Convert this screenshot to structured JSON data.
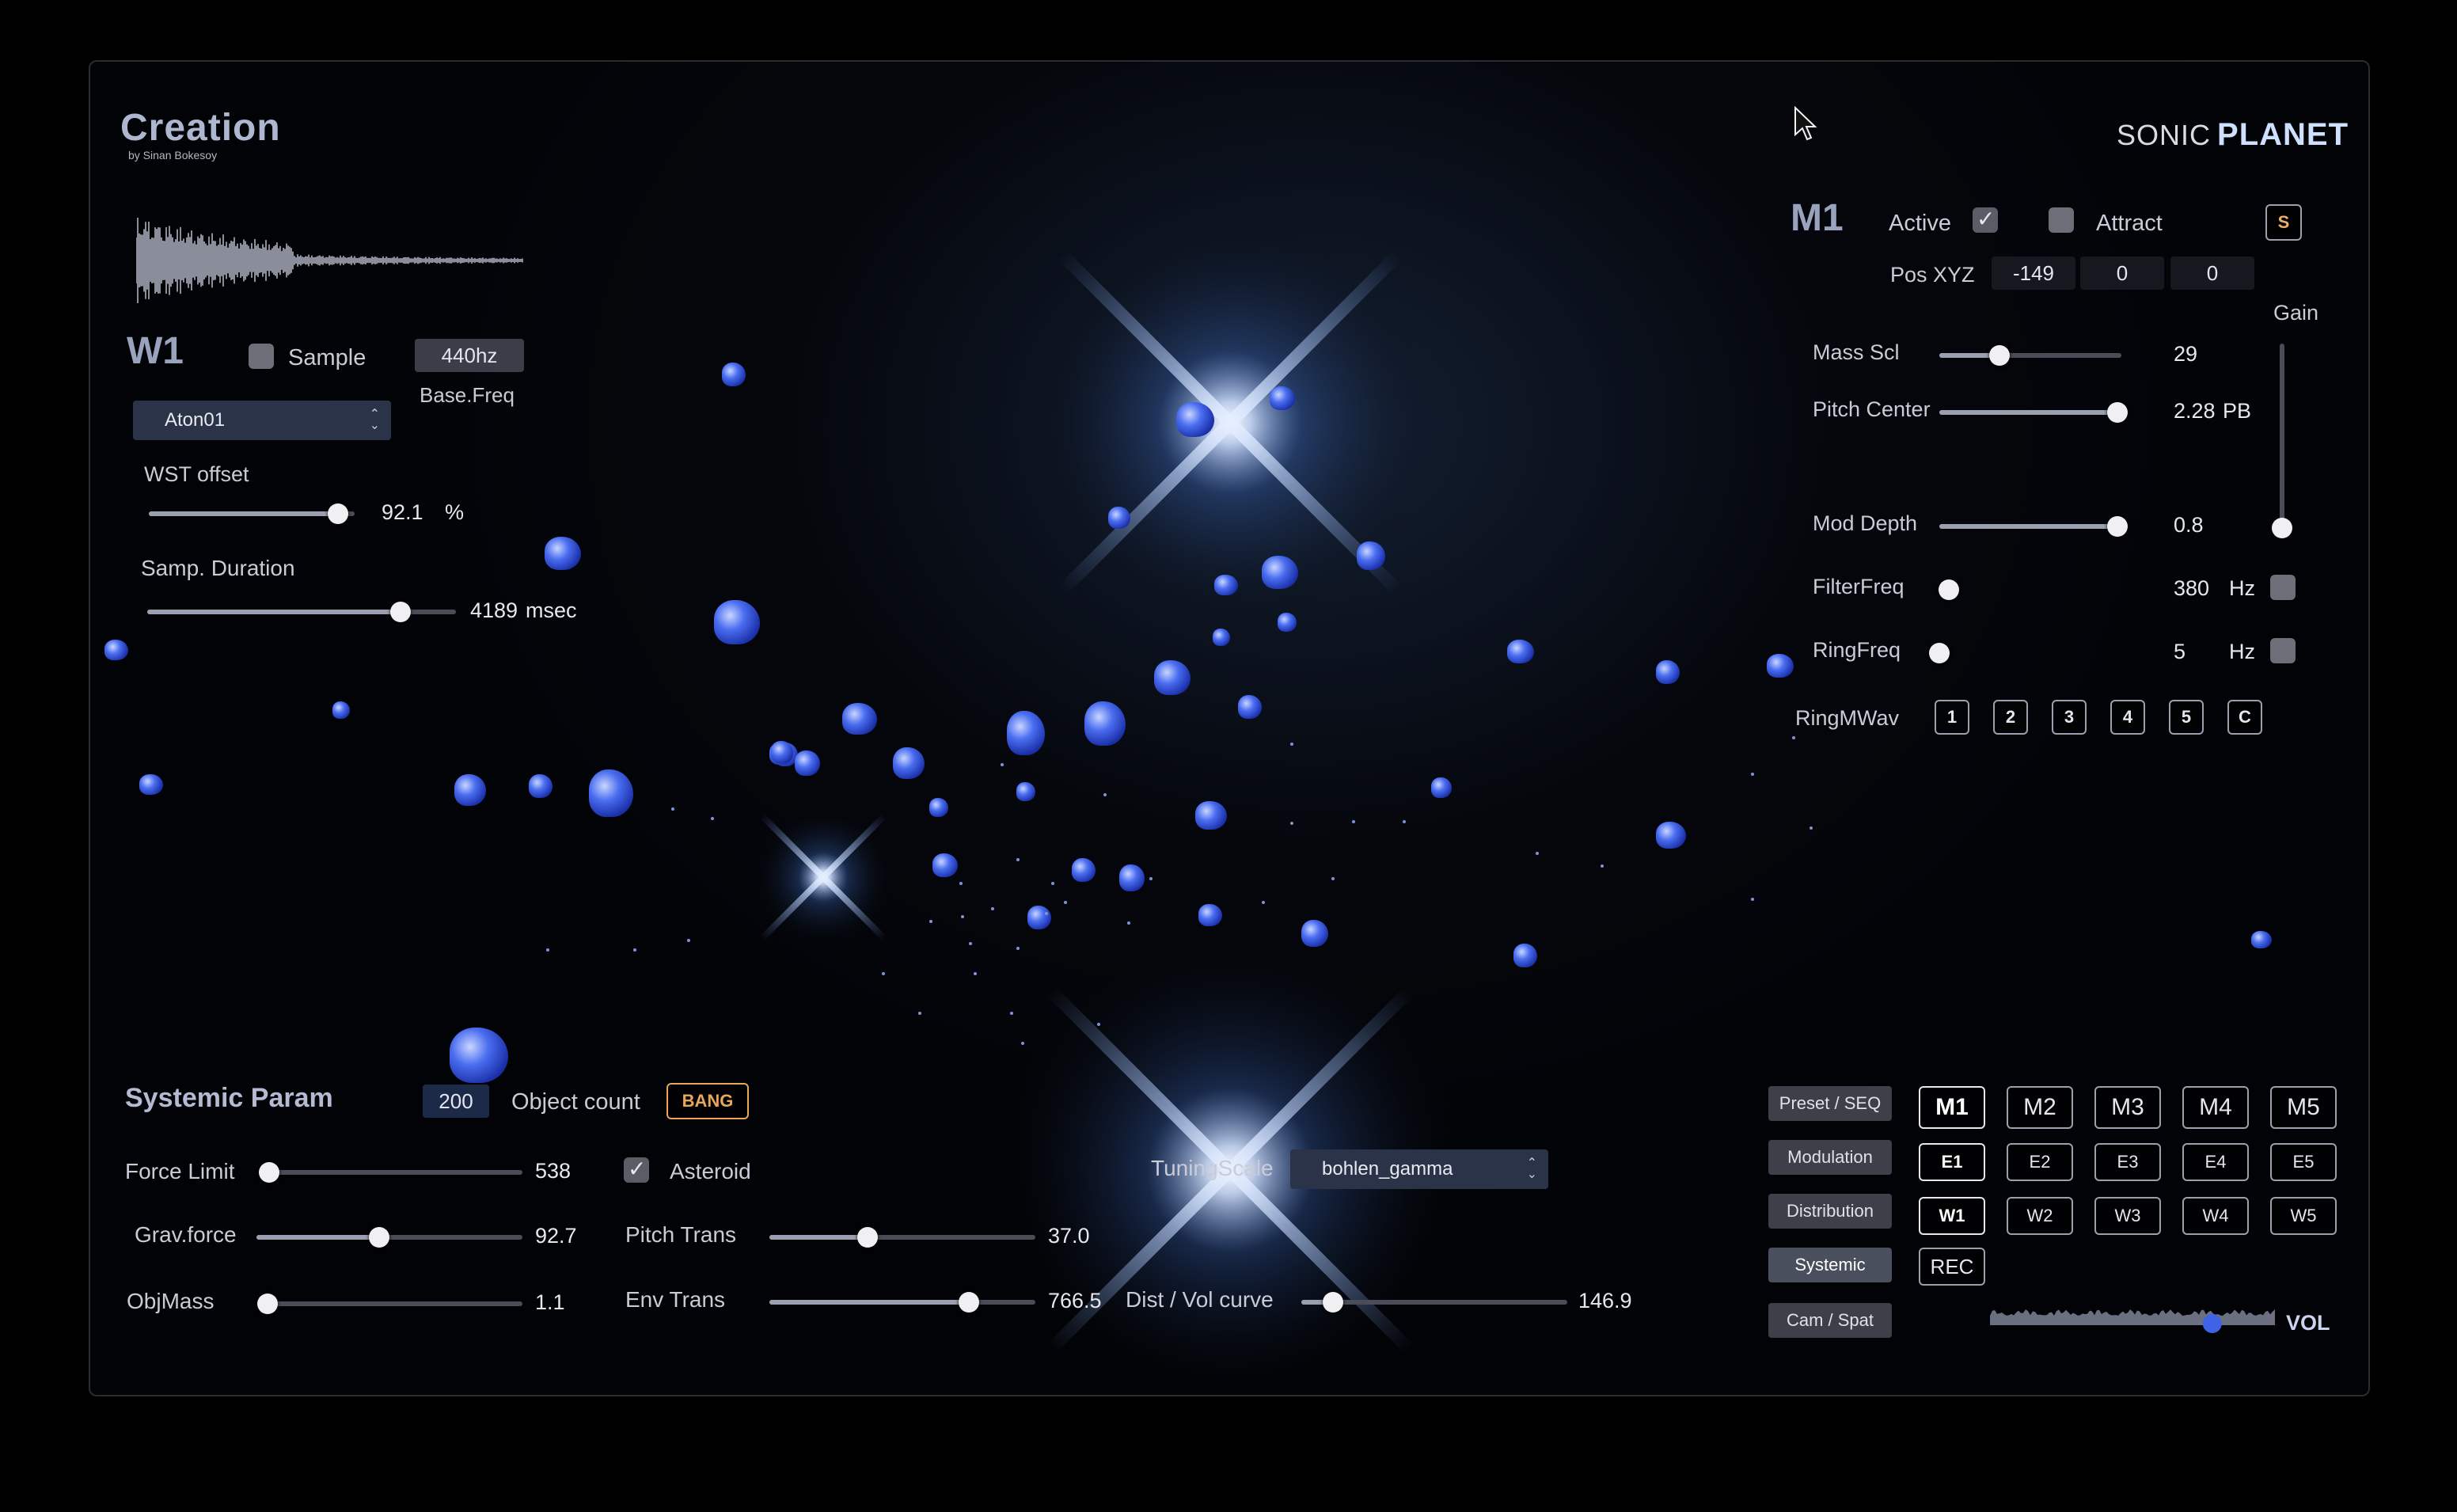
{
  "app": {
    "title": "Creation",
    "subtitle": "by Sinan Bokesoy",
    "brand_sonic": "SONIC",
    "brand_planet": "PLANET"
  },
  "colors": {
    "background": "#000000",
    "space": "#05070d",
    "rock": "#3b5be8",
    "accent": "#9db4ff",
    "bang": "#e8a85a"
  },
  "icons": {
    "cursor": "mouse-pointer-icon",
    "dropdown": "chevron-updown-icon",
    "check": "checkmark-icon"
  },
  "waveform": {
    "name": "W1",
    "sample_label": "Sample",
    "sample_checked": false,
    "base_freq_value": "440hz",
    "base_freq_label": "Base.Freq",
    "preset_select": "Aton01",
    "wst_offset": {
      "label": "WST offset",
      "value": "92.1",
      "unit": "%",
      "fraction": 0.92
    },
    "samp_duration": {
      "label": "Samp. Duration",
      "value": "4189",
      "unit": "msec",
      "fraction": 0.82
    }
  },
  "mass": {
    "name": "M1",
    "active_label": "Active",
    "active_checked": true,
    "attract_label": "Attract",
    "attract_checked": false,
    "s_button": "S",
    "pos_label": "Pos XYZ",
    "pos": [
      "-149",
      "0",
      "0"
    ],
    "gain_label": "Gain",
    "gain_fraction": 0.0,
    "params": [
      {
        "label": "Mass Scl",
        "value": "29",
        "unit": "",
        "fraction": 0.33,
        "toggle": false
      },
      {
        "label": "Pitch Center",
        "value": "2.28",
        "unit": "PB",
        "fraction": 0.98,
        "toggle": false
      },
      {
        "label": "Mod Depth",
        "value": "0.8",
        "unit": "",
        "fraction": 0.98,
        "toggle": false
      },
      {
        "label": "FilterFreq",
        "value": "380",
        "unit": "Hz",
        "fraction": 0.05,
        "toggle": true
      },
      {
        "label": "RingFreq",
        "value": "5",
        "unit": "Hz",
        "fraction": 0.0,
        "toggle": true
      }
    ],
    "ring_wav_label": "RingMWav",
    "ring_wav_buttons": [
      "1",
      "2",
      "3",
      "4",
      "5",
      "C"
    ]
  },
  "systemic": {
    "title": "Systemic Param",
    "object_count_value": "200",
    "object_count_label": "Object count",
    "bang": "BANG",
    "force_limit": {
      "label": "Force Limit",
      "value": "538",
      "fraction": 0.0
    },
    "grav_force": {
      "label": "Grav.force",
      "value": "92.7",
      "fraction": 0.46
    },
    "obj_mass": {
      "label": "ObjMass",
      "value": "1.1",
      "fraction": 0.0
    },
    "asteroid_label": "Asteroid",
    "asteroid_checked": true,
    "pitch_trans": {
      "label": "Pitch Trans",
      "value": "37.0",
      "fraction": 0.37
    },
    "env_trans": {
      "label": "Env Trans",
      "value": "766.5",
      "fraction": 0.75
    },
    "tuning_label": "TuningScale",
    "tuning_value": "bohlen_gamma",
    "dist_vol": {
      "label": "Dist / Vol curve",
      "value": "146.9",
      "fraction": 0.12
    }
  },
  "nav": {
    "sections": [
      "Preset / SEQ",
      "Modulation",
      "Distribution",
      "Systemic",
      "Cam / Spat"
    ],
    "m_row": [
      "M1",
      "M2",
      "M3",
      "M4",
      "M5"
    ],
    "e_row": [
      "E1",
      "E2",
      "E3",
      "E4",
      "E5"
    ],
    "w_row": [
      "W1",
      "W2",
      "W3",
      "W4",
      "W5"
    ],
    "rec": "REC",
    "vol_label": "VOL",
    "vol_fraction": 0.78
  }
}
